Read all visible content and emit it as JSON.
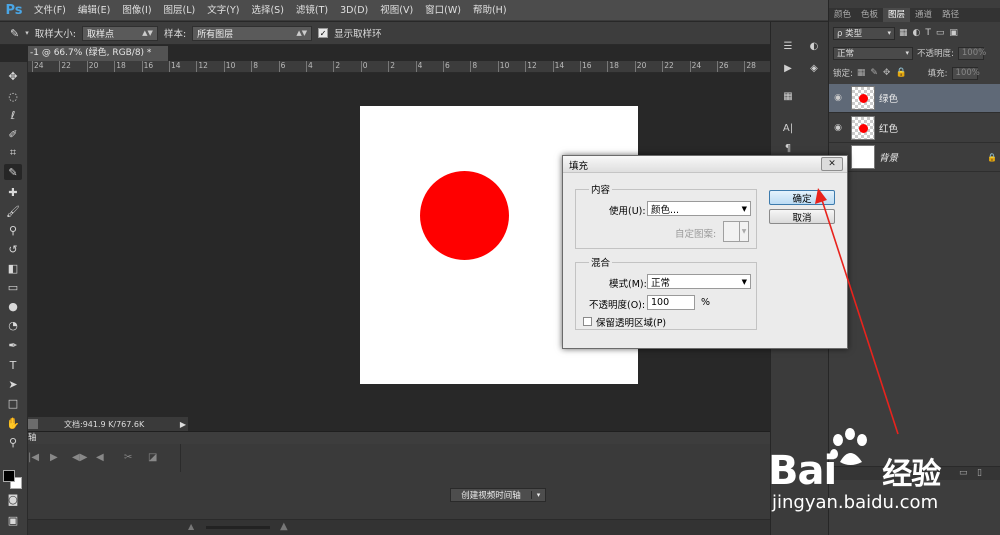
{
  "app": {
    "logo": "Ps",
    "menu": [
      "文件(F)",
      "编辑(E)",
      "图像(I)",
      "图层(L)",
      "文字(Y)",
      "选择(S)",
      "滤镜(T)",
      "3D(D)",
      "视图(V)",
      "窗口(W)",
      "帮助(H)"
    ],
    "window_controls": {
      "minimize": "—",
      "restore": "□",
      "close": "✕"
    }
  },
  "options_bar": {
    "sample_size_label": "取样大小:",
    "sample_size_value": "取样点",
    "sample_label": "样本:",
    "sample_value": "所有图层",
    "show_ring_label": "显示取样环",
    "show_ring_checked": true
  },
  "document": {
    "tab_title": "-1 @ 66.7% (绿色, RGB/8) *",
    "status_text": "文档:941.9 K/767.6K"
  },
  "ruler": {
    "ticks": [
      "24",
      "22",
      "20",
      "18",
      "16",
      "14",
      "12",
      "10",
      "8",
      "6",
      "4",
      "2",
      "0",
      "2",
      "4",
      "6",
      "8",
      "10",
      "12",
      "14",
      "16",
      "18",
      "20",
      "22",
      "24",
      "26",
      "28"
    ]
  },
  "timeline": {
    "tab_label": "轴",
    "create_button_label": "创建视频时间轴"
  },
  "layers_panel": {
    "tabs": [
      "颜色",
      "色板",
      "图层",
      "通道",
      "路径"
    ],
    "active_tab": "图层",
    "filter_label": "ρ 类型",
    "blend_mode": "正常",
    "opacity_label": "不透明度:",
    "opacity_value": "100%",
    "lock_label": "锁定:",
    "fill_label": "填充:",
    "fill_value": "100%",
    "layers": [
      {
        "name": "绿色",
        "selected": true,
        "has_dot": true,
        "italic": false,
        "locked": false
      },
      {
        "name": "红色",
        "selected": false,
        "has_dot": true,
        "italic": false,
        "locked": false
      },
      {
        "name": "背景",
        "selected": false,
        "has_dot": false,
        "italic": true,
        "locked": true
      }
    ]
  },
  "fill_dialog": {
    "title": "填充",
    "close_label": "✕",
    "contents_group": "内容",
    "use_label": "使用(U):",
    "use_value": "颜色...",
    "custom_pattern_label": "自定图案:",
    "blending_group": "混合",
    "mode_label": "模式(M):",
    "mode_value": "正常",
    "opacity_label": "不透明度(O):",
    "opacity_value": "100",
    "opacity_unit": "%",
    "preserve_label": "保留透明区域(P)",
    "preserve_checked": false,
    "ok_label": "确定",
    "cancel_label": "取消"
  },
  "canvas": {
    "background": "#ffffff",
    "circle_color": "#ff0000"
  },
  "annotation": {
    "arrow_color": "#e8231d"
  },
  "watermark": {
    "brand": "Bai",
    "brand_suffix": "经验",
    "domain": "jingyan.baidu.com"
  }
}
